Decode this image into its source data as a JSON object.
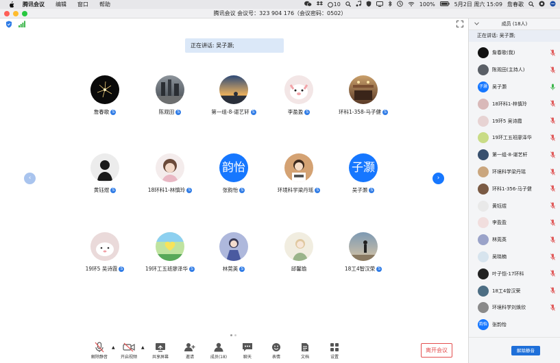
{
  "menubar": {
    "app": "腾讯会议",
    "items": [
      "编辑",
      "窗口",
      "帮助"
    ],
    "status": {
      "badge": "10",
      "battery": "100%",
      "date": "5月2日 周六 15:09",
      "user": "詹春歌"
    }
  },
  "window": {
    "title": "腾讯会议 会议号：323 904 176（会议密码：0502）"
  },
  "main": {
    "speaker_banner": "正在讲话: 吴子灏;",
    "tiles": [
      {
        "name": "詹春歌",
        "avatar": "photo"
      },
      {
        "name": "陈观田",
        "avatar": "photo"
      },
      {
        "name": "第一组-8-谌艺轩",
        "avatar": "photo"
      },
      {
        "name": "李盈盈",
        "avatar": "photo"
      },
      {
        "name": "环科1-358-马子健",
        "avatar": "photo"
      },
      {
        "name": "黄钰煜",
        "avatar": "photo"
      },
      {
        "name": "18环科1-林慎玲",
        "avatar": "photo"
      },
      {
        "name": "张韵怡",
        "avatar_text": "韵怡"
      },
      {
        "name": "环境科学梁丹瑶",
        "avatar": "photo"
      },
      {
        "name": "吴子灏",
        "avatar_text": "子灏"
      },
      {
        "name": "19环5 吴诗霞",
        "avatar": "photo"
      },
      {
        "name": "19环工五班廖泽华",
        "avatar": "photo"
      },
      {
        "name": "林莞英",
        "avatar": "photo"
      },
      {
        "name": "邱馨瑜",
        "avatar": "photo"
      },
      {
        "name": "18工4智汉荣",
        "avatar": "photo"
      }
    ]
  },
  "bottombar": {
    "buttons": [
      "解除静音",
      "开启视频",
      "共享屏幕",
      "邀请",
      "成员(18)",
      "聊天",
      "表情",
      "文档",
      "设置"
    ],
    "leave": "离开会议"
  },
  "sidebar": {
    "title": "成员 (18人)",
    "speaking": "正在讲话: 吴子灏;",
    "members": [
      {
        "name": "詹春歌(我)",
        "avatar_color": "#111111"
      },
      {
        "name": "陈观田(主持人)",
        "avatar_color": "#5a5f66"
      },
      {
        "name": "吴子灏",
        "avatar_text": "子灏",
        "mic": "active"
      },
      {
        "name": "18环科1-林慎玲",
        "avatar_color": "#d9b9b9"
      },
      {
        "name": "19环5 吴诗霞",
        "avatar_color": "#e7d3d3"
      },
      {
        "name": "19环工五班廖泽华",
        "avatar_color": "#c9dc86"
      },
      {
        "name": "第一组-8-谌艺轩",
        "avatar_color": "#38506e"
      },
      {
        "name": "环境科学梁丹瑶",
        "avatar_color": "#caa67e"
      },
      {
        "name": "环科1-356-马子健",
        "avatar_color": "#7a5a44"
      },
      {
        "name": "黄钰煜",
        "avatar_color": "#e9e9e9"
      },
      {
        "name": "李盈盈",
        "avatar_color": "#f1dede"
      },
      {
        "name": "林莞英",
        "avatar_color": "#9aa3c9"
      },
      {
        "name": "吴晓楠",
        "avatar_color": "#d7e4ee"
      },
      {
        "name": "叶子恺-17环科",
        "avatar_color": "#222222"
      },
      {
        "name": "18工4曾汉荣",
        "avatar_color": "#4d6e84"
      },
      {
        "name": "环境科学刘焕欣",
        "avatar_color": "#8a8a8a"
      },
      {
        "name": "张韵怡",
        "avatar_text": "韵怡"
      }
    ],
    "unmute_all": "解除静音"
  },
  "colors": {
    "accent": "#1677ff",
    "danger": "#e34d4d",
    "muted_mic": "#e05a5a",
    "active_mic": "#3bb54a"
  }
}
